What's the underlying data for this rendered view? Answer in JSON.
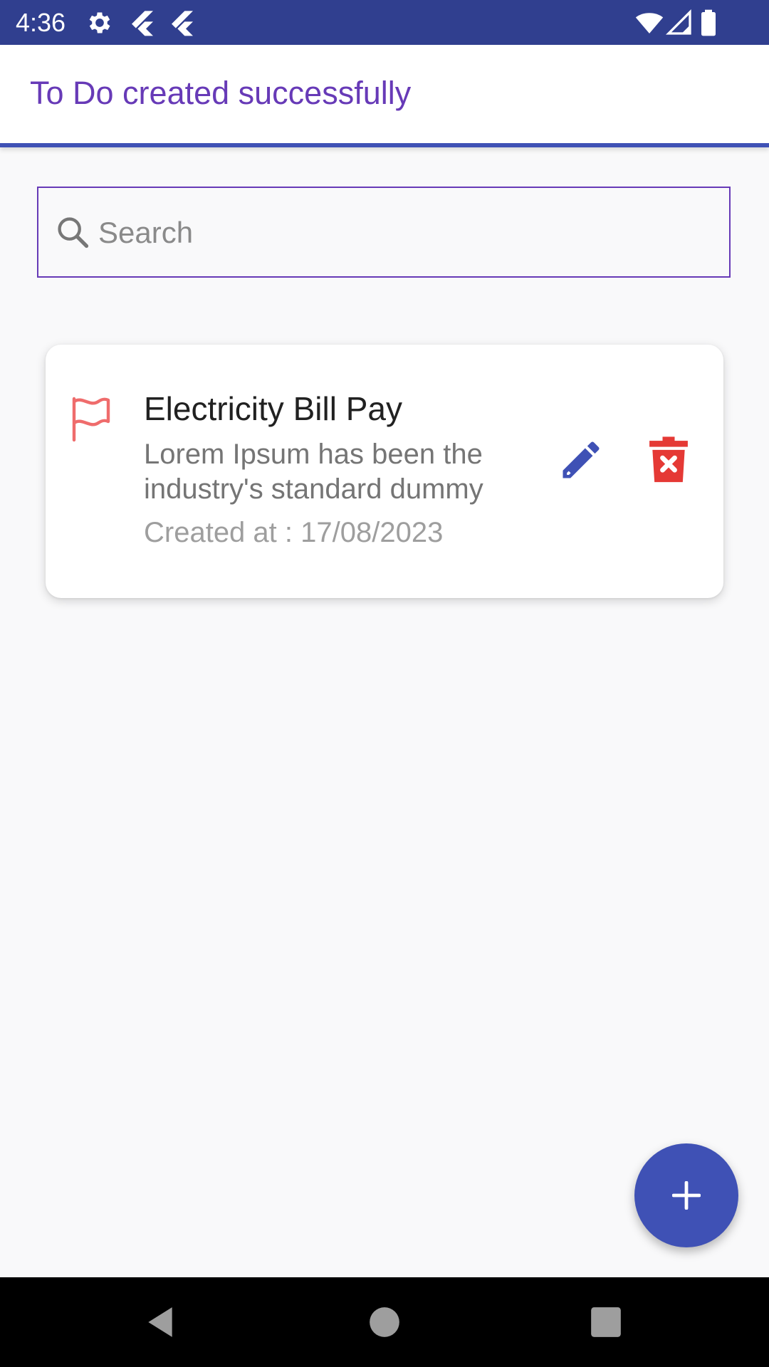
{
  "status_bar": {
    "time": "4:36",
    "left_icons": [
      "gear-icon",
      "flutter-icon",
      "flutter-icon"
    ],
    "right_icons": [
      "wifi-icon",
      "signal-icon",
      "battery-icon"
    ]
  },
  "banner": {
    "message": "To Do created successfully"
  },
  "search": {
    "placeholder": "Search",
    "value": ""
  },
  "todos": [
    {
      "title": "Electricity Bill Pay",
      "description": "Lorem Ipsum has been the industry's standard dummy",
      "created_at": "Created at : 17/08/2023",
      "icon": "flag-icon"
    }
  ],
  "fab": {
    "icon": "plus-icon"
  },
  "nav_bar": {
    "buttons": [
      "back-icon",
      "home-icon",
      "recents-icon"
    ]
  },
  "colors": {
    "status_bar": "#303f8f",
    "accent_purple": "#673ab7",
    "primary_indigo": "#3f51b5",
    "delete_red": "#e53935",
    "flag_red": "#ef6c6c"
  }
}
